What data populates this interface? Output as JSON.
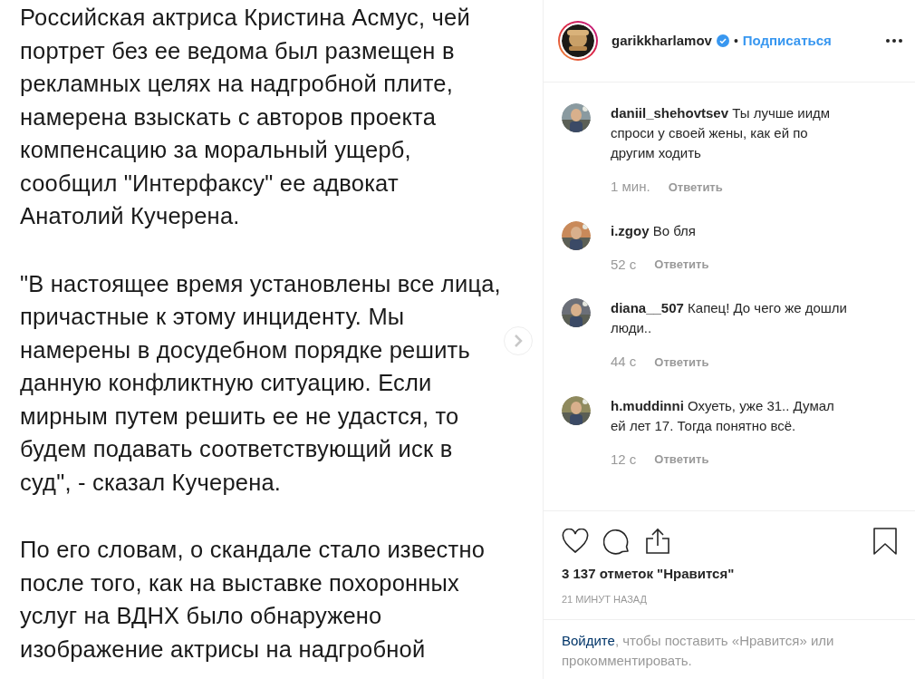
{
  "post_image": {
    "paragraphs": [
      [
        "Российская актриса Кристина Асмус, чей",
        "портрет без ее ведома был размещен в",
        "рекламных целях на надгробной плите,",
        "намерена взыскать с авторов проекта",
        "компенсацию за моральный ущерб,",
        "сообщил \"Интерфаксу\" ее адвокат",
        "Анатолий Кучерена."
      ],
      [
        "\"В настоящее время установлены все лица,",
        "причастные к этому инциденту. Мы",
        "намерены в досудебном порядке решить",
        "данную конфликтную ситуацию. Если",
        "мирным путем решить ее не удастся, то",
        "будем подавать соответствующий иск в",
        "суд\", - сказал Кучерена."
      ],
      [
        "По его словам, о скандале стало известно",
        "после того, как на выставке похоронных",
        "услуг на ВДНХ было обнаружено",
        "изображение актрисы на надгробной"
      ]
    ]
  },
  "header": {
    "username": "garikkharlamov",
    "verified": true,
    "separator": "•",
    "follow": "Подписаться"
  },
  "comments": [
    {
      "username": "daniil_shehovtsev",
      "text": "Ты лучше иидм спроси у своей жены, как ей по другим ходить",
      "time": "1 мин.",
      "reply": "Ответить"
    },
    {
      "username": "i.zgoy",
      "text": "Во бля",
      "time": "52 с",
      "reply": "Ответить"
    },
    {
      "username": "diana__507",
      "text": "Капец! До чего же дошли люди..",
      "time": "44 с",
      "reply": "Ответить"
    },
    {
      "username": "h.muddinni",
      "text": "Охуеть, уже 31.. Думал ей лет 17. Тогда понятно всё.",
      "time": "12 с",
      "reply": "Ответить"
    }
  ],
  "likes": "3 137 отметок \"Нравится\"",
  "posted": "21 МИНУТ НАЗАД",
  "login": {
    "link": "Войдите",
    "text": ", чтобы поставить «Нравится» или прокомментировать."
  }
}
